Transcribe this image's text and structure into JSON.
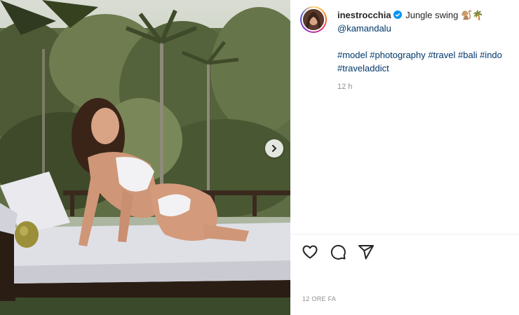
{
  "post": {
    "username": "inestrocchia",
    "caption_text": "Jungle swing",
    "caption_emojis": "🐒🌴",
    "mention": "@kamandalu",
    "hashtags_line1": "#model #photography #travel #bali #indo",
    "hashtags_line2": "#traveladdict",
    "comment_time": "12 h",
    "post_date": "12 ORE FA"
  },
  "icons": {
    "verified": "verified-badge-icon",
    "next": "chevron-right-icon",
    "like": "heart-icon",
    "comment": "comment-icon",
    "share": "paper-plane-icon"
  },
  "colors": {
    "verified_blue": "#0095f6",
    "link": "#00376b",
    "muted": "#8e8e8e"
  }
}
